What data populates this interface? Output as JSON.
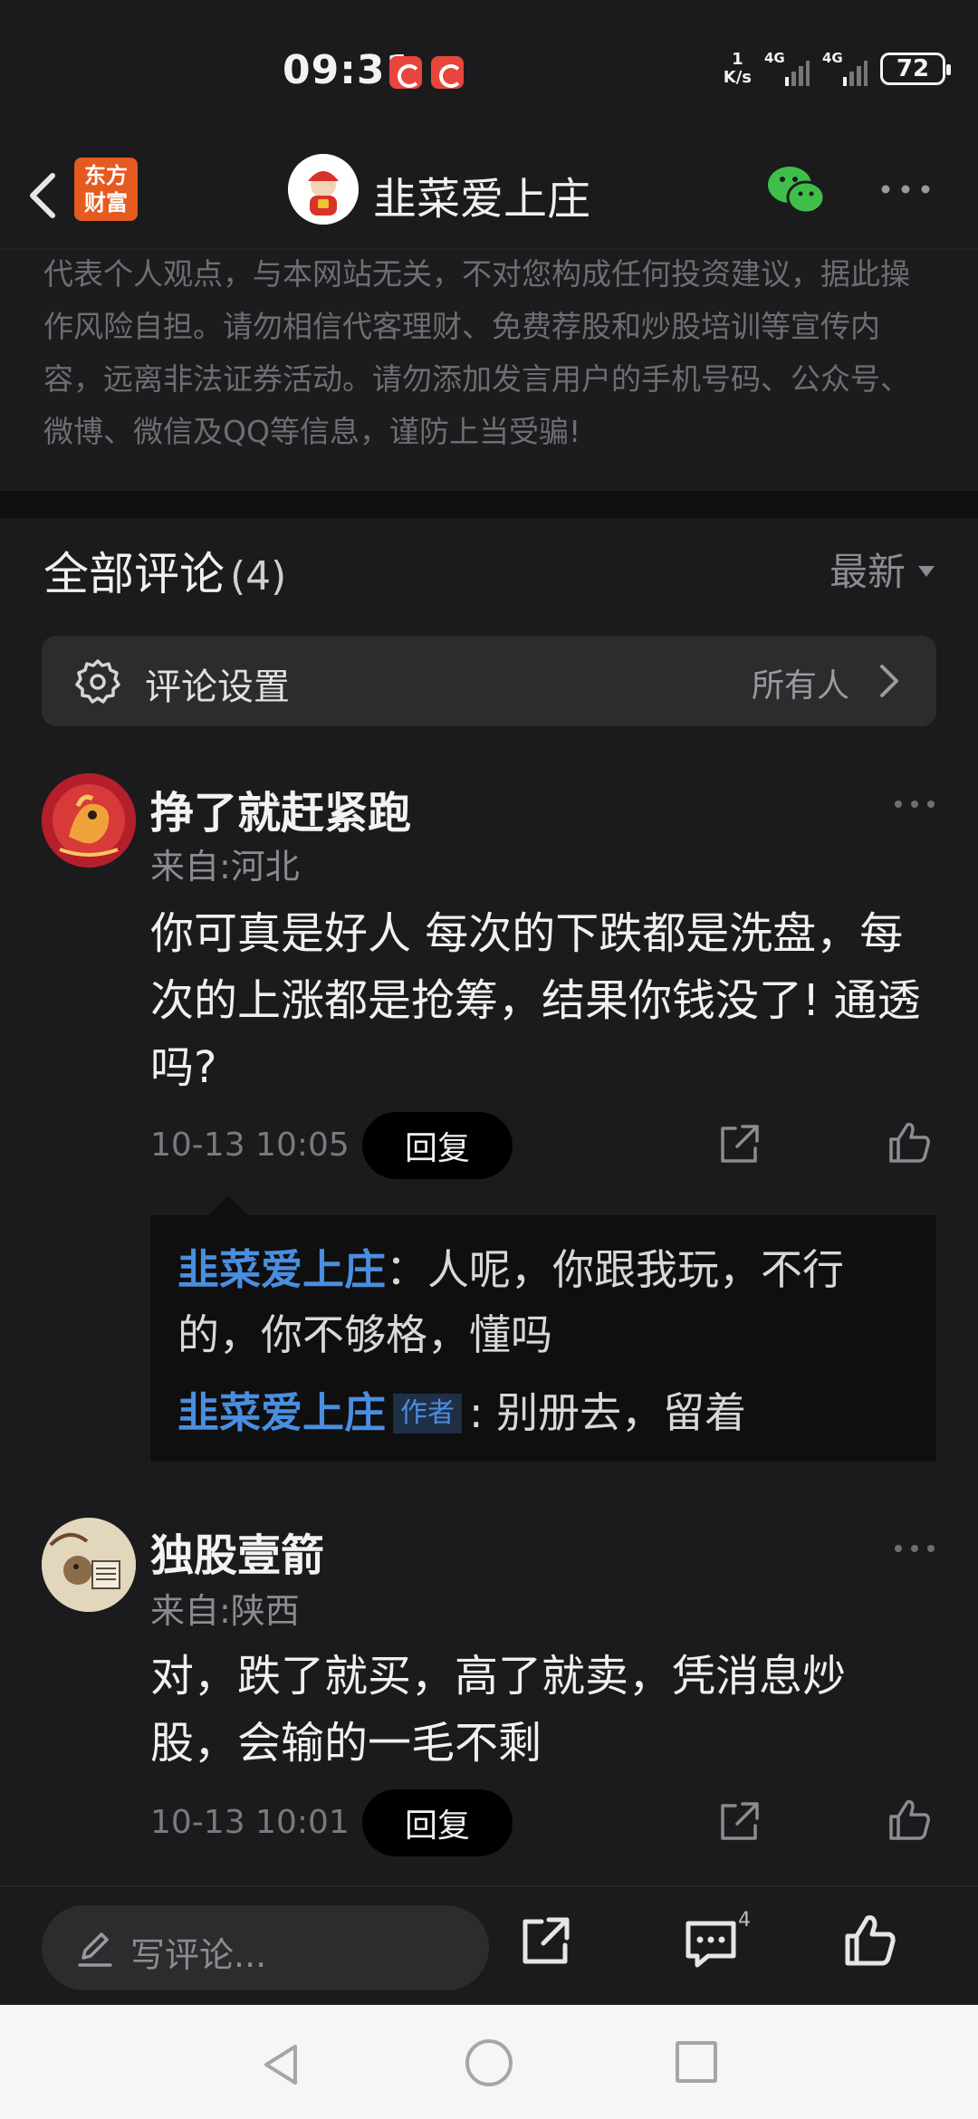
{
  "status_bar": {
    "time": "09:31",
    "net_speed_value": "1",
    "net_speed_unit": "K/s",
    "signal1_label": "4G",
    "signal2_label": "4G",
    "battery": "72"
  },
  "header": {
    "app_logo_text_line1": "东方",
    "app_logo_text_line2": "财富",
    "title": "韭菜爱上庄"
  },
  "disclaimer": {
    "text": "代表个人观点，与本网站无关，不对您构成任何投资建议，据此操作风险自担。请勿相信代客理财、免费荐股和炒股培训等宣传内容，远离非法证券活动。请勿添加发言用户的手机号码、公众号、微博、微信及QQ等信息，谨防上当受骗!"
  },
  "comments_section": {
    "title": "全部评论",
    "count": "(4)",
    "sort_label": "最新",
    "settings_label": "评论设置",
    "settings_value": "所有人"
  },
  "comments": [
    {
      "name": "挣了就赶紧跑",
      "from": "来自:河北",
      "text": "你可真是好人 每次的下跌都是洗盘，每次的上涨都是抢筹，结果你钱没了! 通透吗?",
      "time": "10-13 10:05",
      "reply_label": "回复",
      "replies": [
        {
          "name": "韭菜爱上庄",
          "badge": "",
          "text": "：人呢，你跟我玩，不行的，你不够格，懂吗"
        },
        {
          "name": "韭菜爱上庄",
          "badge": "作者",
          "text": ": 别册去，留着"
        }
      ]
    },
    {
      "name": "独股壹箭",
      "from": "来自:陕西",
      "text": "对，跌了就买，高了就卖，凭消息炒股，会输的一毛不剩",
      "time": "10-13 10:01",
      "reply_label": "回复"
    }
  ],
  "bottom_bar": {
    "write_placeholder": "写评论...",
    "comment_count": "4"
  },
  "colors": {
    "background": "#1b1b1d",
    "accent_blue": "#4a8ee0",
    "wechat_green": "#3fbf4a",
    "logo_orange": "#e55a1f"
  }
}
